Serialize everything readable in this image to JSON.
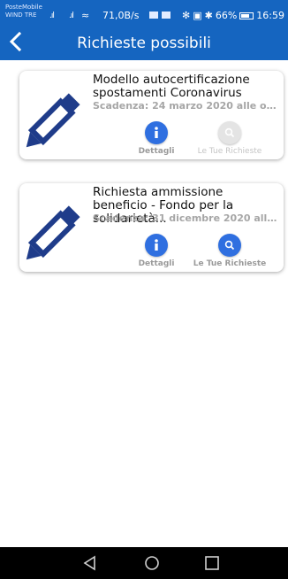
{
  "status_bar": {
    "carrier_line1": "PosteMobile",
    "carrier_line2": "WIND TRE",
    "network_speed": "71,0B/s",
    "battery": "66%",
    "time": "16:59"
  },
  "header": {
    "title": "Richieste possibili",
    "back_icon": "chevron-left-icon"
  },
  "cards": [
    {
      "title": "Modello autocertificazione spostamenti Coronavirus",
      "deadline": "Scadenza: 24 marzo 2020 alle ore 00:...",
      "details_label": "Dettagli",
      "requests_label": "Le Tue Richieste",
      "requests_enabled": false
    },
    {
      "title": "Richiesta ammissione beneficio - Fondo per la solidarietà...",
      "deadline": "Scadenza: 31 dicembre 2020 alle ore...",
      "details_label": "Dettagli",
      "requests_label": "Le Tue Richieste",
      "requests_enabled": true
    }
  ],
  "colors": {
    "primary": "#1565c0",
    "accent": "#2f6fe0",
    "icon_navy": "#1f3c8a",
    "disabled": "#e4e4e4"
  },
  "icons": {
    "card": "pencil-icon",
    "details": "info-icon",
    "requests": "search-icon"
  },
  "nav_bar": [
    "back-triangle-icon",
    "home-circle-icon",
    "recents-square-icon"
  ]
}
